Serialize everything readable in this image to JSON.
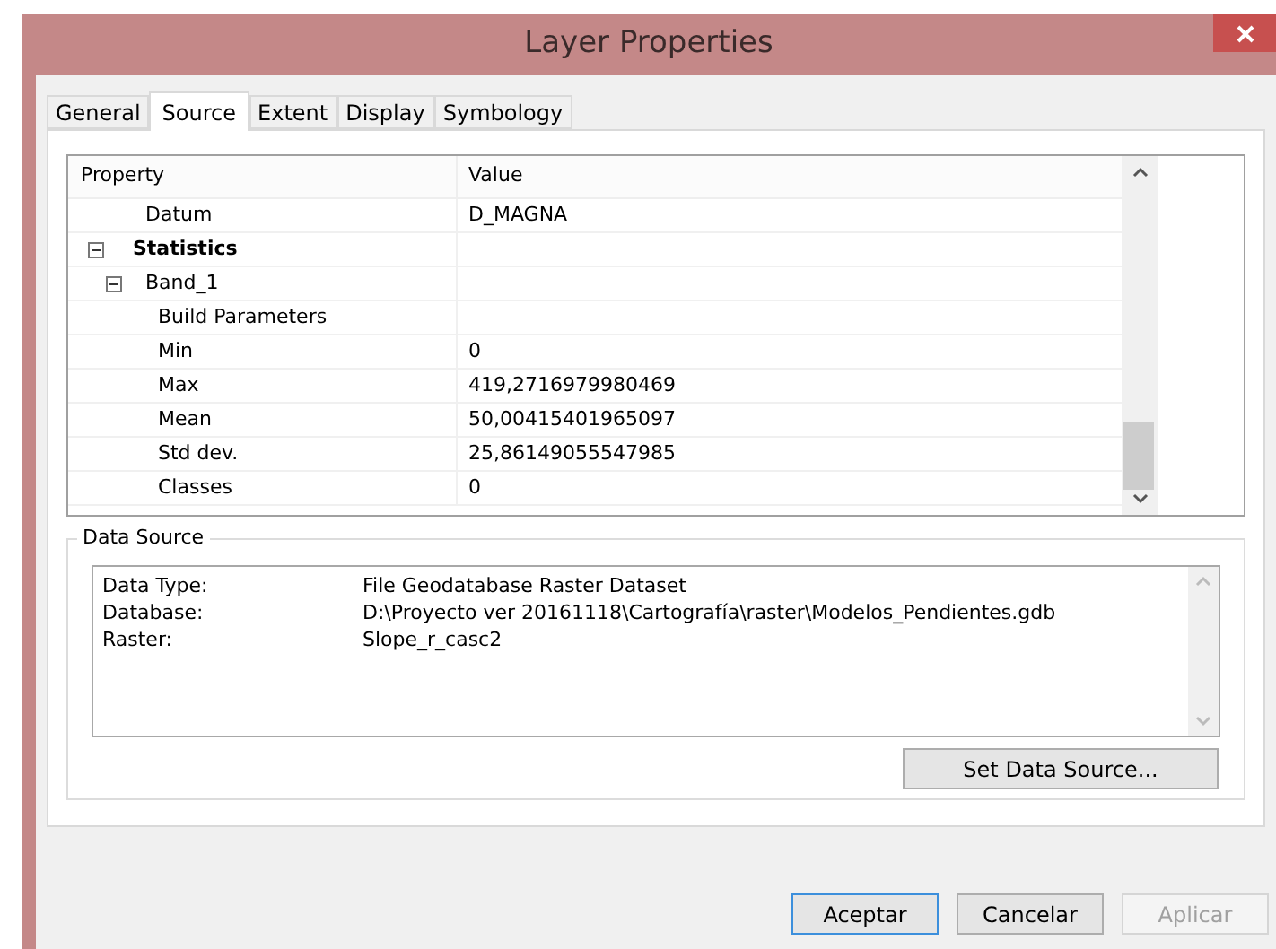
{
  "window": {
    "title": "Layer Properties"
  },
  "tabs": [
    {
      "label": "General",
      "selected": false
    },
    {
      "label": "Source",
      "selected": true
    },
    {
      "label": "Extent",
      "selected": false
    },
    {
      "label": "Display",
      "selected": false
    },
    {
      "label": "Symbology",
      "selected": false
    }
  ],
  "property_grid": {
    "columns": [
      "Property",
      "Value"
    ],
    "rows": [
      {
        "property": "Datum",
        "value": "D_MAGNA"
      },
      {
        "property": "Statistics",
        "expanded": true,
        "children": [
          {
            "property": "Band_1",
            "expanded": true,
            "children": [
              {
                "property": "Build Parameters"
              },
              {
                "property": "Min",
                "value": "0"
              },
              {
                "property": "Max",
                "value": "419,2716979980469"
              },
              {
                "property": "Mean",
                "value": "50,00415401965097"
              },
              {
                "property": "Std dev.",
                "value": "25,86149055547985"
              },
              {
                "property": "Classes",
                "value": "0"
              }
            ]
          }
        ]
      }
    ]
  },
  "data_source": {
    "title": "Data Source",
    "fields": [
      {
        "label": "Data Type:",
        "value": "File Geodatabase Raster Dataset"
      },
      {
        "label": "Database:",
        "value": "D:\\Proyecto ver 20161118\\Cartografía\\raster\\Modelos_Pendientes.gdb"
      },
      {
        "label": "Raster:",
        "value": "Slope_r_casc2"
      }
    ],
    "button": "Set Data Source..."
  },
  "buttons": [
    {
      "label": "Aceptar",
      "disabled": false,
      "default": true
    },
    {
      "label": "Cancelar",
      "disabled": false,
      "default": false
    },
    {
      "label": "Aplicar",
      "disabled": true,
      "default": false
    }
  ]
}
